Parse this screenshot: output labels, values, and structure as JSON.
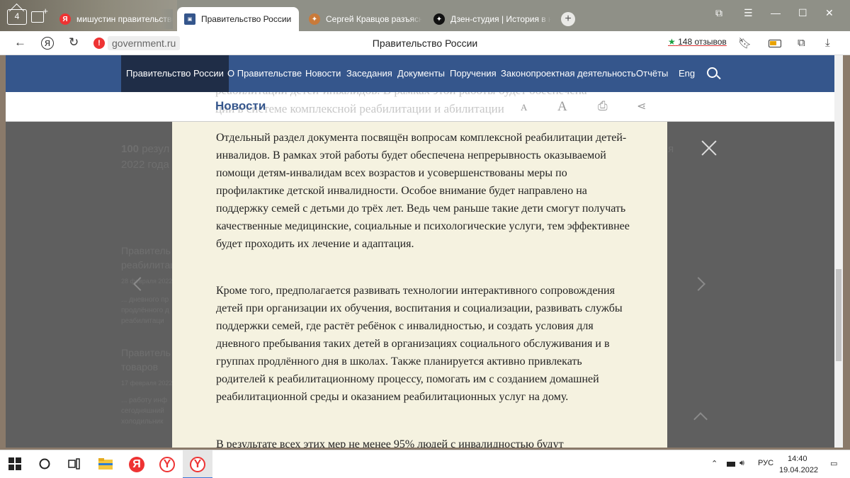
{
  "browser": {
    "tab_count": "4",
    "tabs": [
      {
        "label": "мишустин правительство",
        "favicon": "Я",
        "color": "#e33"
      },
      {
        "label": "Правительство России",
        "favicon": "gov",
        "color": "#35568c"
      },
      {
        "label": "Сергей Кравцов разъясни",
        "favicon": "bird",
        "color": "#c97a3a"
      },
      {
        "label": "Дзен-студия | История в н",
        "favicon": "zen",
        "color": "#111"
      }
    ],
    "new_tab_label": "+",
    "address": {
      "domain": "government.ru",
      "page_title": "Правительство России",
      "reviews": "148 отзывов",
      "reviews_star": "★"
    }
  },
  "site_nav": {
    "items": [
      "Правительство России",
      "О Правительстве",
      "Новости",
      "Заседания",
      "Документы",
      "Поручения",
      "Законопроектная деятельность",
      "Отчёты",
      "Eng"
    ]
  },
  "subheader": {
    "title": "Новости",
    "ghost_line1": "реабилитации детей-инвалидов. В рамках этой работы будет обеспечена",
    "ghost_line2": "ции в системе комплексной реабилитации и абилитации",
    "font_small": "A",
    "font_large": "A"
  },
  "background": {
    "count_prefix": "100",
    "count_suffix": "резул",
    "year": "2022 года",
    "right_fragment": "я",
    "item1_title1": "Правитель",
    "item1_title2": "реабилитац",
    "item1_date": "28 февраля 2022",
    "item1_snip1": "... дневного пр",
    "item1_snip2": "продлённого д",
    "item1_snip3": "реабилитаци",
    "item2_title1": "Правитель",
    "item2_title2": "товаров",
    "item2_date": "17 февраля 2022",
    "item2_snip1": "... работу инф",
    "item2_snip2": "сегодняшний",
    "item2_snip3": "холодильник"
  },
  "article": {
    "p1": "Отдельный раздел документа посвящён вопросам комплексной реабилитации детей-инвалидов. В рамках этой работы будет обеспечена непрерывность оказываемой помощи детям-инвалидам всех возрастов и усовершенствованы меры по профилактике детской инвалидности. Особое внимание будет направлено на поддержку семей с детьми до трёх лет. Ведь чем раньше такие дети смогут получать качественные медицинские, социальные и психологические услуги, тем эффективнее будет проходить их лечение и адаптация.",
    "p2": "Кроме того, предполагается развивать технологии интерактивного сопровождения детей при организации их обучения, воспитания и социализации, развивать службы поддержки семей, где растёт ребёнок с инвалидностью, и создать условия для дневного пребывания таких детей в организациях социального обслуживания и в группах продлённого дня в школах. Также планируется активно привлекать родителей к реабилитационному процессу, помогать им с созданием домашней реабилитационной среды и оказанием реабилитационных услуг на дому.",
    "p3": "В результате всех этих мер не менее 95% людей с инвалидностью будут"
  },
  "taskbar": {
    "lang": "РУС",
    "time": "14:40",
    "date": "19.04.2022"
  }
}
